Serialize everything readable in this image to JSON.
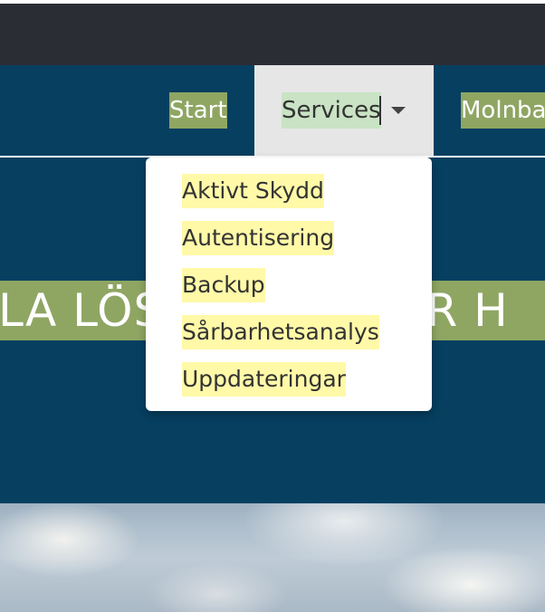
{
  "colors": {
    "topbar": "#2b2d35",
    "navbar": "#063f60",
    "highlight_green": "#8fa663",
    "highlight_yellow": "#fff9a8",
    "services_bg": "#e6e6e6"
  },
  "nav": {
    "items": [
      {
        "label": "Start"
      },
      {
        "label": "Services",
        "active": true,
        "icon": "caret-down-icon"
      },
      {
        "label": "Molnba"
      }
    ]
  },
  "dropdown": {
    "items": [
      {
        "label": "Aktivt Skydd"
      },
      {
        "label": "Autentisering"
      },
      {
        "label": "Backup"
      },
      {
        "label": "Sårbarhetsanalys"
      },
      {
        "label": "Uppdateringar"
      }
    ]
  },
  "hero": {
    "visible_text": "LA LÖSNINGAR FÖR H"
  }
}
